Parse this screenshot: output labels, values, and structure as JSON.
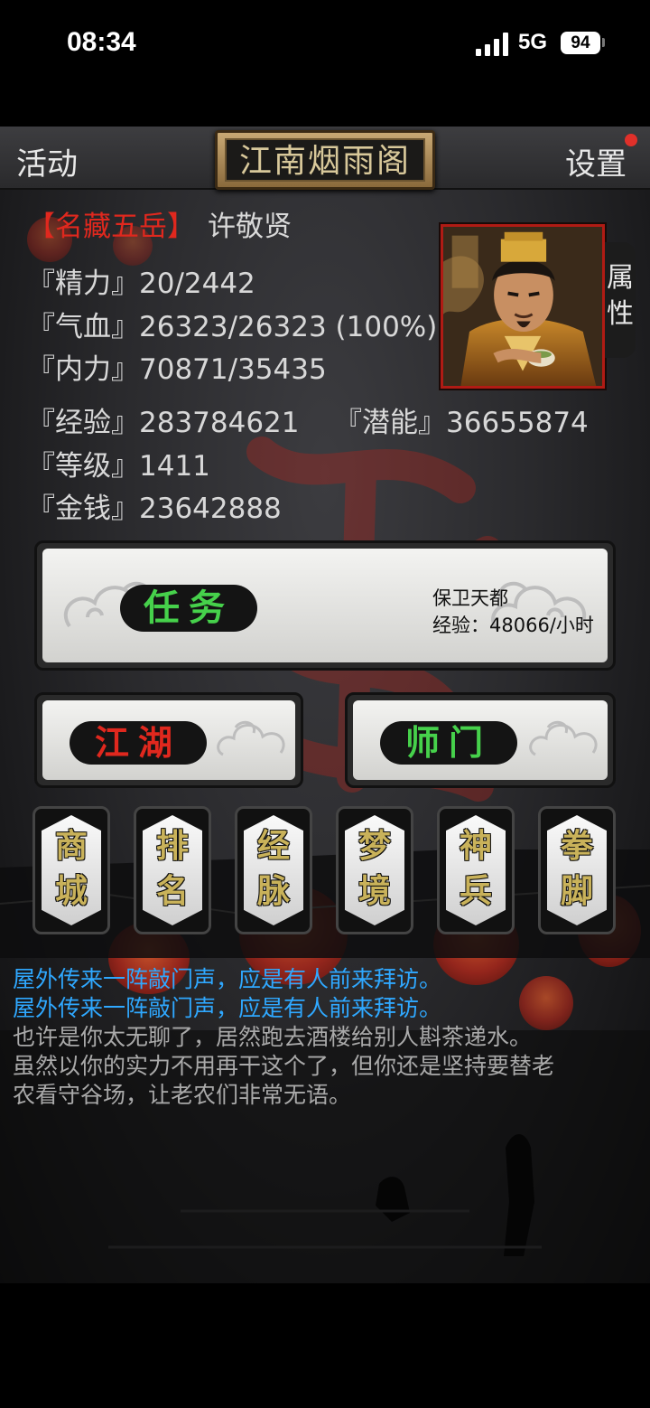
{
  "status_bar": {
    "time": "08:34",
    "network": "5G",
    "battery": "94"
  },
  "topbar": {
    "left_label": "活动",
    "title": "江南烟雨阁",
    "right_label": "设置"
  },
  "character": {
    "title_tag": "【名藏五岳】",
    "name": "许敬贤",
    "attr_tab_label": "属\n性",
    "stats": {
      "energy_label": "『精力』",
      "energy_value": "20/2442",
      "hp_label": "『气血』",
      "hp_value": "26323/26323 (100%)",
      "mp_label": "『内力』",
      "mp_value": "70871/35435",
      "exp_label": "『经验』",
      "exp_value": "283784621",
      "potential_label": "『潜能』",
      "potential_value": "36655874",
      "level_label": "『等级』",
      "level_value": "1411",
      "money_label": "『金钱』",
      "money_value": "23642888"
    }
  },
  "quest": {
    "button_label": "任务",
    "name": "保卫天都",
    "rate": "经验：48066/小时"
  },
  "jianghu_label": "江湖",
  "shimen_label": "师门",
  "menu": [
    {
      "id": "shop",
      "label": "商\n城"
    },
    {
      "id": "rank",
      "label": "排\n名"
    },
    {
      "id": "meridian",
      "label": "经\n脉"
    },
    {
      "id": "dream",
      "label": "梦\n境"
    },
    {
      "id": "weapon",
      "label": "神\n兵"
    },
    {
      "id": "fist",
      "label": "拳\n脚"
    }
  ],
  "log": [
    {
      "text": "屋外传来一阵敲门声，应是有人前来拜访。",
      "color": "#2fa8ff"
    },
    {
      "text": "屋外传来一阵敲门声，应是有人前来拜访。",
      "color": "#2fa8ff"
    },
    {
      "text": "也许是你太无聊了，居然跑去酒楼给别人斟茶递水。",
      "color": "#a9a9a9"
    },
    {
      "text": "虽然以你的实力不用再干这个了，但你还是坚持要替老",
      "color": "#a9a9a9"
    },
    {
      "text": "农看守谷场，让老农们非常无语。",
      "color": "#a9a9a9"
    }
  ],
  "colors": {
    "title_red": "#e0281e",
    "quest_green": "#46d14b",
    "jianghu_red": "#e0281e",
    "shimen_green": "#46d14b",
    "menu_gold": "#c9b25a",
    "log_blue": "#2fa8ff",
    "log_gray": "#a9a9a9"
  },
  "icons": [
    "signal-icon",
    "battery-icon",
    "notification-dot-icon",
    "cloud-ornament-icon",
    "portrait-image"
  ]
}
